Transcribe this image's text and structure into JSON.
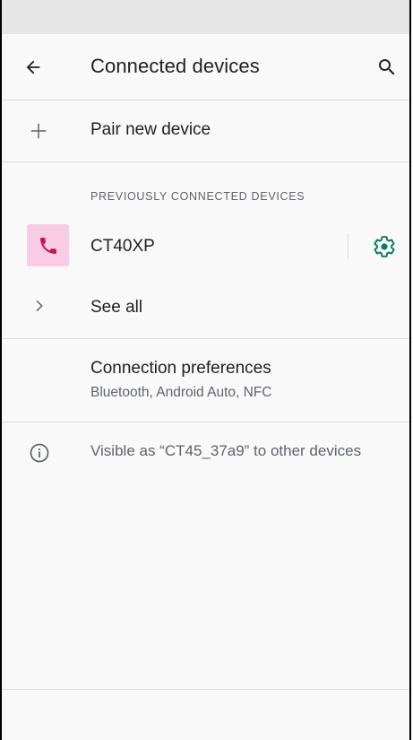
{
  "header": {
    "title": "Connected devices",
    "back_icon": "arrow-back-icon",
    "search_icon": "search-icon"
  },
  "pair_row": {
    "icon": "plus-icon",
    "label": "Pair new device"
  },
  "previous_section": {
    "header": "PREVIOUSLY CONNECTED DEVICES",
    "device": {
      "icon": "phone-icon",
      "name": "CT40XP",
      "settings_icon": "gear-icon"
    }
  },
  "see_all_row": {
    "icon": "chevron-right-icon",
    "label": "See all"
  },
  "preferences_row": {
    "title": "Connection preferences",
    "subtitle": "Bluetooth, Android Auto, NFC"
  },
  "visibility_row": {
    "icon": "info-icon",
    "text": "Visible as “CT45_37a9” to other devices"
  },
  "colors": {
    "accent_teal": "#0d7a5f",
    "phone_icon": "#c2185b",
    "phone_icon_bg": "#f8cce3",
    "primary_text": "#202124",
    "secondary_text": "#5f6368"
  }
}
